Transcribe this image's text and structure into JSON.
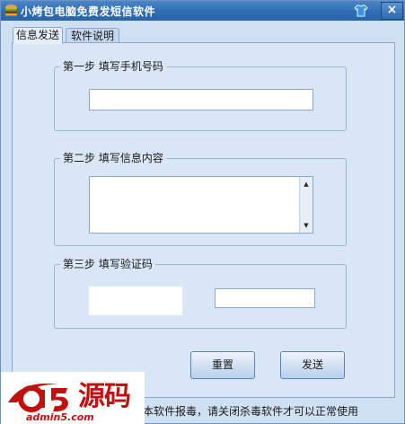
{
  "window": {
    "title": "小烤包电脑免费发短信软件",
    "close_label": "×"
  },
  "tabs": [
    {
      "label": "信息发送",
      "active": true
    },
    {
      "label": "软件说明",
      "active": false
    }
  ],
  "steps": {
    "step1": {
      "legend": "第一步  填写手机号码",
      "phone_value": ""
    },
    "step2": {
      "legend": "第二步  填写信息内容",
      "message_value": ""
    },
    "step3": {
      "legend": "第三步  填写验证码",
      "captcha_value": ""
    }
  },
  "buttons": {
    "reset_label": "重置",
    "send_label": "发送"
  },
  "footer": {
    "notice": "本软件报毒，请关闭杀毒软件才可以正常使用"
  },
  "watermark": {
    "cn_text": "源码",
    "url_text": "admin5.com"
  },
  "colors": {
    "titlebar": "#2f6db3",
    "panel": "#d8e6f6",
    "brand_red": "#c21010"
  },
  "icons": {
    "app": "burger-icon",
    "skin": "shirt-icon",
    "close": "close-icon",
    "scroll_up": "arrow-up-icon",
    "scroll_down": "arrow-down-icon"
  }
}
